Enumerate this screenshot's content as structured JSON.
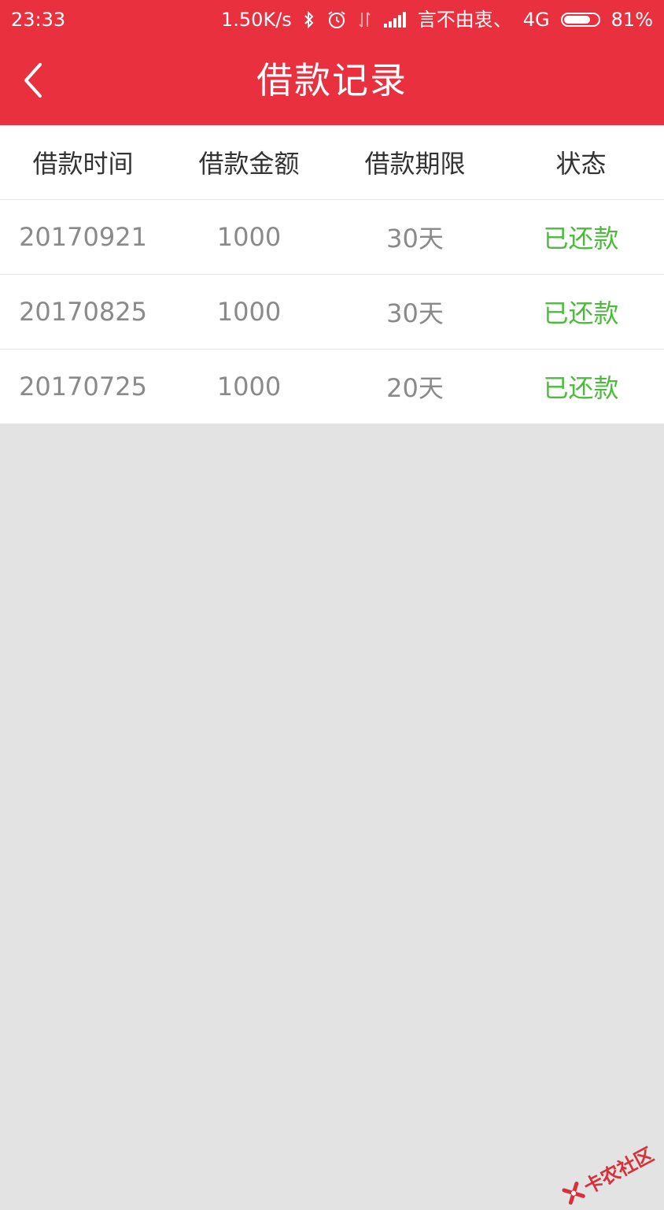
{
  "status_bar": {
    "time": "23:33",
    "net_speed": "1.50K/s",
    "carrier": "言不由衷、",
    "network": "4G",
    "battery": "81%",
    "battery_level": 0.81,
    "icons": [
      "bluetooth-icon",
      "alarm-icon",
      "data-transfer-icon",
      "signal-icon",
      "battery-icon"
    ]
  },
  "nav": {
    "title": "借款记录",
    "back_icon": "chevron-left-icon"
  },
  "table": {
    "headers": [
      "借款时间",
      "借款金额",
      "借款期限",
      "状态"
    ],
    "rows": [
      {
        "date": "20170921",
        "amount": "1000",
        "term": "30天",
        "status": "已还款"
      },
      {
        "date": "20170825",
        "amount": "1000",
        "term": "30天",
        "status": "已还款"
      },
      {
        "date": "20170725",
        "amount": "1000",
        "term": "20天",
        "status": "已还款"
      }
    ]
  },
  "watermark": {
    "text": "卡农社区"
  },
  "colors": {
    "header_red": "#e8303f",
    "status_green": "#4cbb3c",
    "background_gray": "#e3e3e3",
    "text_gray": "#8a8a8a"
  }
}
